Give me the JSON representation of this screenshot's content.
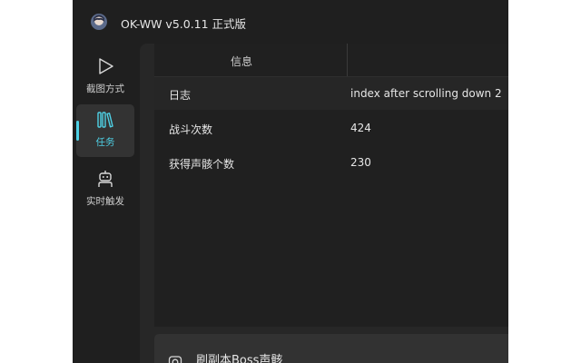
{
  "window": {
    "title": "OK-WW v5.0.11 正式版"
  },
  "sidebar": {
    "items": [
      {
        "label": "截图方式",
        "icon": "play-icon",
        "active": false
      },
      {
        "label": "任务",
        "icon": "library-icon",
        "active": true
      },
      {
        "label": "实时触发",
        "icon": "robot-icon",
        "active": false
      }
    ]
  },
  "info_table": {
    "columns": [
      "信息",
      ""
    ],
    "rows": [
      {
        "key": "日志",
        "value": "index after scrolling down 2"
      },
      {
        "key": "战斗次数",
        "value": "424"
      },
      {
        "key": "获得声骸个数",
        "value": "230"
      }
    ]
  },
  "task_card": {
    "title": "刷副本Boss声骸",
    "icon": "camera-icon"
  },
  "colors": {
    "accent": "#4fd1e6",
    "window_bg": "#1f1f1f",
    "content_bg": "#272727"
  }
}
